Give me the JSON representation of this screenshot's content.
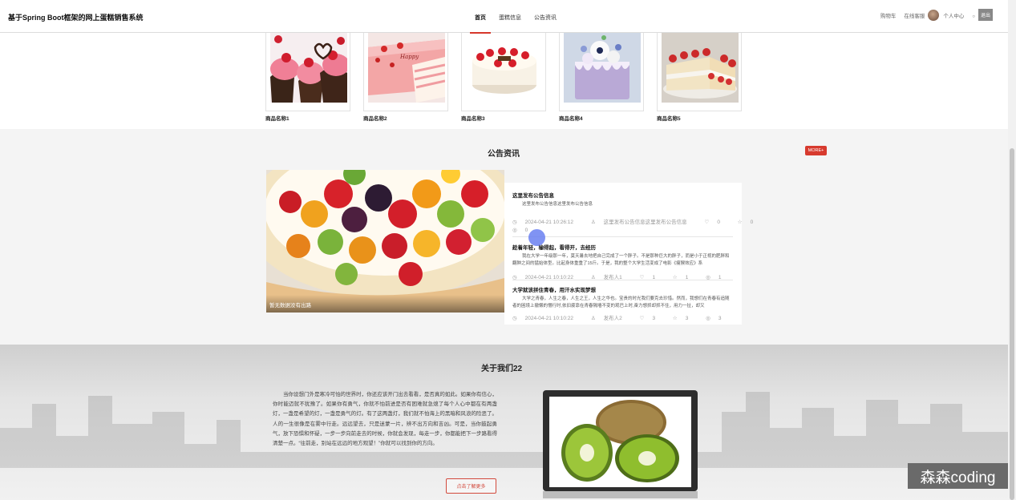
{
  "header": {
    "title": "基于Spring Boot框架的网上蛋糕销售系统",
    "nav": [
      "首页",
      "蛋糕信息",
      "公告资讯"
    ],
    "cart": "购物车",
    "online_service": "在线客服",
    "personal_center": "个人中心",
    "logout": "退出"
  },
  "products": [
    {
      "name": "商品名称1"
    },
    {
      "name": "商品名称2"
    },
    {
      "name": "商品名称3"
    },
    {
      "name": "商品名称4"
    },
    {
      "name": "商品名称5"
    }
  ],
  "notice": {
    "title": "公告资讯",
    "more": "MORE+",
    "image_caption": "暂无数据没有出路",
    "items": [
      {
        "title": "这里发布公告信息",
        "body": "这里发布公告信息这里发布公告信息",
        "date": "2024-04-21 10:26:12",
        "author": "这里发布公告信息这里发布公告信息",
        "likes": "0",
        "collects": "0",
        "views": "0"
      },
      {
        "title": "趁着年轻，输得起，看得开，去经历",
        "body": "我在大学一年级那一年，莫天暑去地把自己完成了一个胖子。不是那种巨大的胖子，而是小于正视的肥胖和翻肿之间的猛始体型。比起身体重重了15斤。于是，我的整个大学生活变成了电影《瘦猴效应》系",
        "date": "2024-04-21 10:10:22",
        "author": "发布人1",
        "likes": "1",
        "collects": "1",
        "views": "1"
      },
      {
        "title": "大学就该拼住青春，用汗水实现梦想",
        "body": "大学之青春，人生之春，人生之王，人生之华也。宝贵的时光我们要克去珍惜。然而，我想们在青春有追随者的困境上撤懒的懵行时,依旧疲靠在青春隔墙不变的观巴上时,奋力想抓却抓不住，用力一扯，却又",
        "date": "2024-04-21 10:10:22",
        "author": "发布人2",
        "likes": "3",
        "collects": "3",
        "views": "3"
      }
    ]
  },
  "about": {
    "title": "关于我们22",
    "text": "当你设想门外是寒冷可怕的世界时，你还应该开门出去看看，是否真的如此。如果你有信心，你时能迈就不犹豫了。如果你有勇气，你就不怕前进是否有困难就急熄了每个人心中都在有两盏灯，一盏是希望的灯，一盏是勇气的灯。有了这两盏灯，我们就不怕海上的黑暗和风浪的险恶了。人的一生很像是在雾中行走。远远望去，只是迷蒙一片，辨不出方向和吉凶。可是，当你鼓起勇气，放下恐惧和怀疑，一步一步向前走去的时候，你就会发现，每走一步，你都能把下一步路看得清楚一点。“往前走，别站在远远的地方观望！”你就可以找到你的方向。",
    "more_button": "点击了解更多"
  },
  "watermark": "森森coding",
  "icons": [
    "user-icon",
    "clock-icon",
    "thumb-up-icon",
    "star-icon",
    "eye-icon"
  ]
}
